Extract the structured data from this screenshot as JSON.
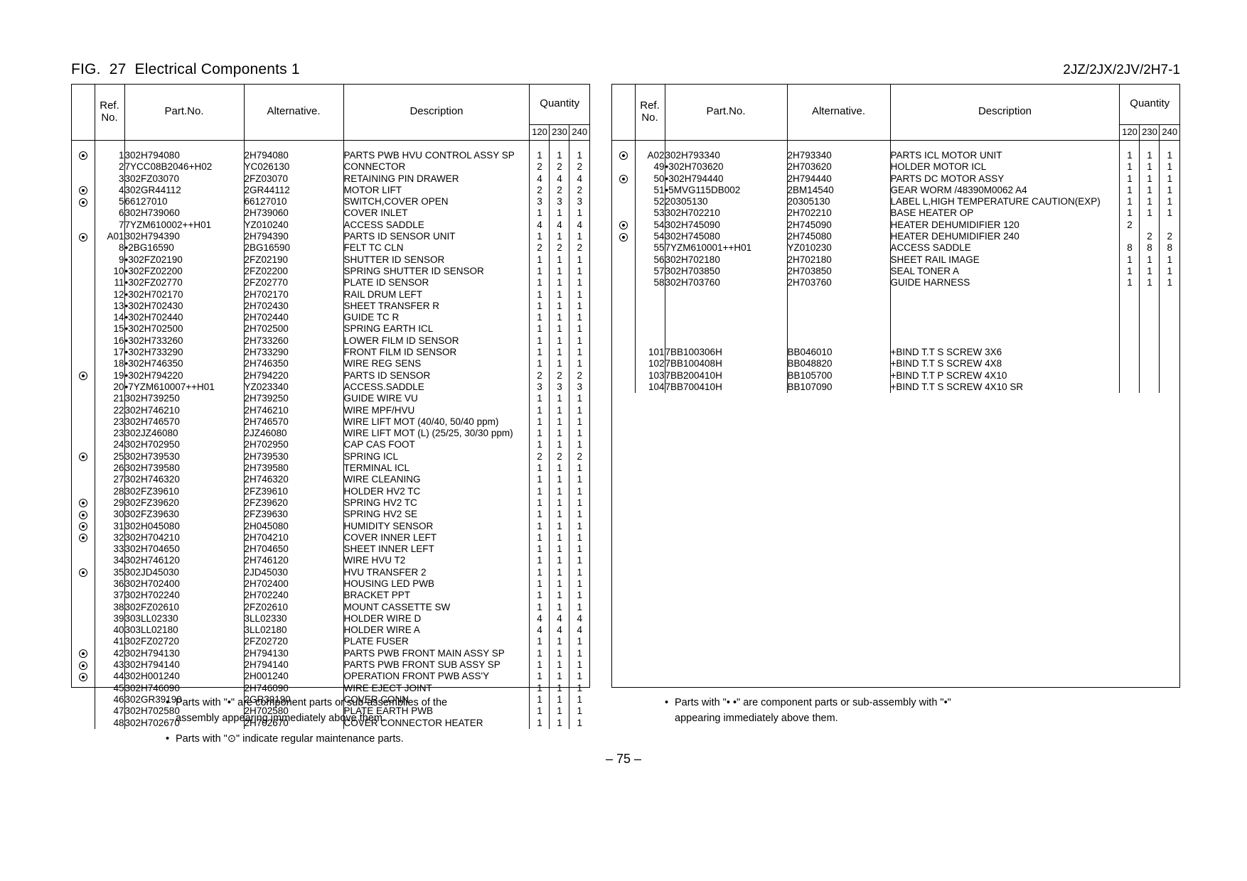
{
  "header": {
    "fig_title": "FIG.  27  Electrical Components 1",
    "model_code": "2JZ/2JX/2JV/2H7-1"
  },
  "columns": {
    "mark": "",
    "ref_line1": "Ref.",
    "ref_line2": "No.",
    "part": "Part.No.",
    "alternative": "Alternative.",
    "description": "Description",
    "quantity": "Quantity",
    "q120": "120",
    "q230": "230",
    "q240": "240"
  },
  "left_rows": [
    {
      "mark": true,
      "ref": "1",
      "part": "302H794080",
      "alt": "2H794080",
      "desc": "PARTS PWB HVU CONTROL ASSY SP",
      "q120": "1",
      "q230": "1",
      "q240": "1"
    },
    {
      "mark": false,
      "ref": "2",
      "part": "7YCC08B2046+H02",
      "alt": "YC026130",
      "desc": "CONNECTOR",
      "q120": "2",
      "q230": "2",
      "q240": "2"
    },
    {
      "mark": false,
      "ref": "3",
      "part": "302FZ03070",
      "alt": "2FZ03070",
      "desc": "RETAINING PIN DRAWER",
      "q120": "4",
      "q230": "4",
      "q240": "4"
    },
    {
      "mark": true,
      "ref": "4",
      "part": "302GR44112",
      "alt": "2GR44112",
      "desc": "MOTOR LIFT",
      "q120": "2",
      "q230": "2",
      "q240": "2"
    },
    {
      "mark": true,
      "ref": "5",
      "part": "66127010",
      "alt": "66127010",
      "desc": "SWITCH,COVER OPEN",
      "q120": "3",
      "q230": "3",
      "q240": "3"
    },
    {
      "mark": false,
      "ref": "6",
      "part": "302H739060",
      "alt": "2H739060",
      "desc": "COVER INLET",
      "q120": "1",
      "q230": "1",
      "q240": "1"
    },
    {
      "mark": false,
      "ref": "7",
      "part": "7YZM610002++H01",
      "alt": "YZ010240",
      "desc": "ACCESS SADDLE",
      "q120": "4",
      "q230": "4",
      "q240": "4"
    },
    {
      "mark": true,
      "ref": "A01",
      "part": "302H794390",
      "alt": "2H794390",
      "desc": "PARTS ID SENSOR UNIT",
      "q120": "1",
      "q230": "1",
      "q240": "1"
    },
    {
      "mark": false,
      "ref": "8",
      "part": "•2BG16590",
      "alt": "2BG16590",
      "desc": "FELT TC CLN",
      "q120": "2",
      "q230": "2",
      "q240": "2"
    },
    {
      "mark": false,
      "ref": "9",
      "part": "•302FZ02190",
      "alt": "2FZ02190",
      "desc": "SHUTTER ID SENSOR",
      "q120": "1",
      "q230": "1",
      "q240": "1"
    },
    {
      "mark": false,
      "ref": "10",
      "part": "•302FZ02200",
      "alt": "2FZ02200",
      "desc": "SPRING SHUTTER ID SENSOR",
      "q120": "1",
      "q230": "1",
      "q240": "1"
    },
    {
      "mark": false,
      "ref": "11",
      "part": "•302FZ02770",
      "alt": "2FZ02770",
      "desc": "PLATE ID SENSOR",
      "q120": "1",
      "q230": "1",
      "q240": "1"
    },
    {
      "mark": false,
      "ref": "12",
      "part": "•302H702170",
      "alt": "2H702170",
      "desc": "RAIL DRUM LEFT",
      "q120": "1",
      "q230": "1",
      "q240": "1"
    },
    {
      "mark": false,
      "ref": "13",
      "part": "•302H702430",
      "alt": "2H702430",
      "desc": "SHEET TRANSFER R",
      "q120": "1",
      "q230": "1",
      "q240": "1"
    },
    {
      "mark": false,
      "ref": "14",
      "part": "•302H702440",
      "alt": "2H702440",
      "desc": "GUIDE TC R",
      "q120": "1",
      "q230": "1",
      "q240": "1"
    },
    {
      "mark": false,
      "ref": "15",
      "part": "•302H702500",
      "alt": "2H702500",
      "desc": "SPRING EARTH ICL",
      "q120": "1",
      "q230": "1",
      "q240": "1"
    },
    {
      "mark": false,
      "ref": "16",
      "part": "•302H733260",
      "alt": "2H733260",
      "desc": "LOWER FILM ID SENSOR",
      "q120": "1",
      "q230": "1",
      "q240": "1"
    },
    {
      "mark": false,
      "ref": "17",
      "part": "•302H733290",
      "alt": "2H733290",
      "desc": "FRONT FILM ID SENSOR",
      "q120": "1",
      "q230": "1",
      "q240": "1"
    },
    {
      "mark": false,
      "ref": "18",
      "part": "•302H746350",
      "alt": "2H746350",
      "desc": "WIRE REG SENS",
      "q120": "1",
      "q230": "1",
      "q240": "1"
    },
    {
      "mark": true,
      "ref": "19",
      "part": "•302H794220",
      "alt": "2H794220",
      "desc": "PARTS ID SENSOR",
      "q120": "2",
      "q230": "2",
      "q240": "2"
    },
    {
      "mark": false,
      "ref": "20",
      "part": "•7YZM610007++H01",
      "alt": "YZ023340",
      "desc": "ACCESS.SADDLE",
      "q120": "3",
      "q230": "3",
      "q240": "3"
    },
    {
      "mark": false,
      "ref": "21",
      "part": "302H739250",
      "alt": "2H739250",
      "desc": "GUIDE WIRE VU",
      "q120": "1",
      "q230": "1",
      "q240": "1"
    },
    {
      "mark": false,
      "ref": "22",
      "part": "302H746210",
      "alt": "2H746210",
      "desc": "WIRE MPF/HVU",
      "q120": "1",
      "q230": "1",
      "q240": "1"
    },
    {
      "mark": false,
      "ref": "23",
      "part": "302H746570",
      "alt": "2H746570",
      "desc": "WIRE LIFT MOT (40/40, 50/40 ppm)",
      "q120": "1",
      "q230": "1",
      "q240": "1"
    },
    {
      "mark": false,
      "ref": "23",
      "part": "302JZ46080",
      "alt": "2JZ46080",
      "desc": "WIRE LIFT MOT (L) (25/25, 30/30 ppm)",
      "q120": "1",
      "q230": "1",
      "q240": "1"
    },
    {
      "mark": false,
      "ref": "24",
      "part": "302H702950",
      "alt": "2H702950",
      "desc": "CAP CAS FOOT",
      "q120": "1",
      "q230": "1",
      "q240": "1"
    },
    {
      "mark": true,
      "ref": "25",
      "part": "302H739530",
      "alt": "2H739530",
      "desc": "SPRING ICL",
      "q120": "2",
      "q230": "2",
      "q240": "2"
    },
    {
      "mark": false,
      "ref": "26",
      "part": "302H739580",
      "alt": "2H739580",
      "desc": "TERMINAL ICL",
      "q120": "1",
      "q230": "1",
      "q240": "1"
    },
    {
      "mark": false,
      "ref": "27",
      "part": "302H746320",
      "alt": "2H746320",
      "desc": "WIRE CLEANING",
      "q120": "1",
      "q230": "1",
      "q240": "1"
    },
    {
      "mark": false,
      "ref": "28",
      "part": "302FZ39610",
      "alt": "2FZ39610",
      "desc": "HOLDER HV2 TC",
      "q120": "1",
      "q230": "1",
      "q240": "1"
    },
    {
      "mark": true,
      "ref": "29",
      "part": "302FZ39620",
      "alt": "2FZ39620",
      "desc": "SPRING HV2 TC",
      "q120": "1",
      "q230": "1",
      "q240": "1"
    },
    {
      "mark": true,
      "ref": "30",
      "part": "302FZ39630",
      "alt": "2FZ39630",
      "desc": "SPRING HV2 SE",
      "q120": "1",
      "q230": "1",
      "q240": "1"
    },
    {
      "mark": true,
      "ref": "31",
      "part": "302H045080",
      "alt": "2H045080",
      "desc": "HUMIDITY SENSOR",
      "q120": "1",
      "q230": "1",
      "q240": "1"
    },
    {
      "mark": true,
      "ref": "32",
      "part": "302H704210",
      "alt": "2H704210",
      "desc": "COVER INNER LEFT",
      "q120": "1",
      "q230": "1",
      "q240": "1"
    },
    {
      "mark": false,
      "ref": "33",
      "part": "302H704650",
      "alt": "2H704650",
      "desc": "SHEET INNER LEFT",
      "q120": "1",
      "q230": "1",
      "q240": "1"
    },
    {
      "mark": false,
      "ref": "34",
      "part": "302H746120",
      "alt": "2H746120",
      "desc": "WIRE HVU T2",
      "q120": "1",
      "q230": "1",
      "q240": "1"
    },
    {
      "mark": true,
      "ref": "35",
      "part": "302JD45030",
      "alt": "2JD45030",
      "desc": "HVU TRANSFER 2",
      "q120": "1",
      "q230": "1",
      "q240": "1"
    },
    {
      "mark": false,
      "ref": "36",
      "part": "302H702400",
      "alt": "2H702400",
      "desc": "HOUSING LED PWB",
      "q120": "1",
      "q230": "1",
      "q240": "1"
    },
    {
      "mark": false,
      "ref": "37",
      "part": "302H702240",
      "alt": "2H702240",
      "desc": "BRACKET PPT",
      "q120": "1",
      "q230": "1",
      "q240": "1"
    },
    {
      "mark": false,
      "ref": "38",
      "part": "302FZ02610",
      "alt": "2FZ02610",
      "desc": "MOUNT CASSETTE SW",
      "q120": "1",
      "q230": "1",
      "q240": "1"
    },
    {
      "mark": false,
      "ref": "39",
      "part": "303LL02330",
      "alt": "3LL02330",
      "desc": "HOLDER WIRE D",
      "q120": "4",
      "q230": "4",
      "q240": "4"
    },
    {
      "mark": false,
      "ref": "40",
      "part": "303LL02180",
      "alt": "3LL02180",
      "desc": "HOLDER WIRE A",
      "q120": "4",
      "q230": "4",
      "q240": "4"
    },
    {
      "mark": false,
      "ref": "41",
      "part": "302FZ02720",
      "alt": "2FZ02720",
      "desc": "PLATE FUSER",
      "q120": "1",
      "q230": "1",
      "q240": "1"
    },
    {
      "mark": true,
      "ref": "42",
      "part": "302H794130",
      "alt": "2H794130",
      "desc": "PARTS PWB FRONT MAIN ASSY SP",
      "q120": "1",
      "q230": "1",
      "q240": "1"
    },
    {
      "mark": true,
      "ref": "43",
      "part": "302H794140",
      "alt": "2H794140",
      "desc": "PARTS PWB FRONT SUB ASSY SP",
      "q120": "1",
      "q230": "1",
      "q240": "1"
    },
    {
      "mark": true,
      "ref": "44",
      "part": "302H001240",
      "alt": "2H001240",
      "desc": "OPERATION FRONT PWB ASS'Y",
      "q120": "1",
      "q230": "1",
      "q240": "1"
    },
    {
      "mark": false,
      "ref": "45",
      "part": "302H746090",
      "alt": "2H746090",
      "desc": "WIRE EJECT JOINT",
      "q120": "1",
      "q230": "1",
      "q240": "1"
    },
    {
      "mark": false,
      "ref": "46",
      "part": "302GR39190",
      "alt": "2GR39190",
      "desc": "COVER CONN",
      "q120": "1",
      "q230": "1",
      "q240": "1"
    },
    {
      "mark": false,
      "ref": "47",
      "part": "302H702580",
      "alt": "2H702580",
      "desc": "PLATE EARTH PWB",
      "q120": "1",
      "q230": "1",
      "q240": "1"
    },
    {
      "mark": false,
      "ref": "48",
      "part": "302H702670",
      "alt": "2H702670",
      "desc": "COVER CONNECTOR HEATER",
      "q120": "1",
      "q230": "1",
      "q240": "1"
    }
  ],
  "right_rows": [
    {
      "mark": true,
      "ref": "A02",
      "part": "302H793340",
      "alt": "2H793340",
      "desc": "PARTS ICL MOTOR UNIT",
      "q120": "1",
      "q230": "1",
      "q240": "1"
    },
    {
      "mark": false,
      "ref": "49",
      "part": "•302H703620",
      "alt": "2H703620",
      "desc": "HOLDER MOTOR ICL",
      "q120": "1",
      "q230": "1",
      "q240": "1"
    },
    {
      "mark": true,
      "ref": "50",
      "part": "•302H794440",
      "alt": "2H794440",
      "desc": "PARTS DC MOTOR ASSY",
      "q120": "1",
      "q230": "1",
      "q240": "1"
    },
    {
      "mark": false,
      "ref": "51",
      "part": "•5MVG115DB002",
      "alt": "2BM14540",
      "desc": "GEAR WORM /48390M0062 A4",
      "q120": "1",
      "q230": "1",
      "q240": "1"
    },
    {
      "mark": false,
      "ref": "52",
      "part": "20305130",
      "alt": "20305130",
      "desc": "LABEL L,HIGH TEMPERATURE CAUTION(EXP)",
      "q120": "1",
      "q230": "1",
      "q240": "1"
    },
    {
      "mark": false,
      "ref": "53",
      "part": "302H702210",
      "alt": "2H702210",
      "desc": "BASE HEATER OP",
      "q120": "1",
      "q230": "1",
      "q240": "1"
    },
    {
      "mark": true,
      "ref": "54",
      "part": "302H745090",
      "alt": "2H745090",
      "desc": "HEATER DEHUMIDIFIER 120",
      "q120": "2",
      "q230": "",
      "q240": ""
    },
    {
      "mark": true,
      "ref": "54",
      "part": "302H745080",
      "alt": "2H745080",
      "desc": "HEATER DEHUMIDIFIER 240",
      "q120": "",
      "q230": "2",
      "q240": "2"
    },
    {
      "mark": false,
      "ref": "55",
      "part": "7YZM610001++H01",
      "alt": "YZ010230",
      "desc": "ACCESS SADDLE",
      "q120": "8",
      "q230": "8",
      "q240": "8"
    },
    {
      "mark": false,
      "ref": "56",
      "part": "302H702180",
      "alt": "2H702180",
      "desc": "SHEET RAIL IMAGE",
      "q120": "1",
      "q230": "1",
      "q240": "1"
    },
    {
      "mark": false,
      "ref": "57",
      "part": "302H703850",
      "alt": "2H703850",
      "desc": "SEAL TONER A",
      "q120": "1",
      "q230": "1",
      "q240": "1"
    },
    {
      "mark": false,
      "ref": "58",
      "part": "302H703760",
      "alt": "2H703760",
      "desc": "GUIDE HARNESS",
      "q120": "1",
      "q230": "1",
      "q240": "1"
    },
    {
      "mark": false,
      "ref": "",
      "part": "",
      "alt": "",
      "desc": "",
      "q120": "",
      "q230": "",
      "q240": ""
    },
    {
      "mark": false,
      "ref": "",
      "part": "",
      "alt": "",
      "desc": "",
      "q120": "",
      "q230": "",
      "q240": ""
    },
    {
      "mark": false,
      "ref": "",
      "part": "",
      "alt": "",
      "desc": "",
      "q120": "",
      "q230": "",
      "q240": ""
    },
    {
      "mark": false,
      "ref": "",
      "part": "",
      "alt": "",
      "desc": "",
      "q120": "",
      "q230": "",
      "q240": ""
    },
    {
      "mark": false,
      "ref": "",
      "part": "",
      "alt": "",
      "desc": "",
      "q120": "",
      "q230": "",
      "q240": ""
    },
    {
      "mark": false,
      "ref": "101",
      "part": "7BB100306H",
      "alt": "BB046010",
      "desc": "+BIND T.T S SCREW 3X6",
      "q120": "",
      "q230": "",
      "q240": ""
    },
    {
      "mark": false,
      "ref": "102",
      "part": "7BB100408H",
      "alt": "BB048820",
      "desc": "+BIND T.T S SCREW 4X8",
      "q120": "",
      "q230": "",
      "q240": ""
    },
    {
      "mark": false,
      "ref": "103",
      "part": "7BB200410H",
      "alt": "BB105700",
      "desc": "+BIND T.T P SCREW 4X10",
      "q120": "",
      "q230": "",
      "q240": ""
    },
    {
      "mark": false,
      "ref": "104",
      "part": "7BB700410H",
      "alt": "BB107090",
      "desc": "+BIND T.T S SCREW 4X10 SR",
      "q120": "",
      "q230": "",
      "q240": ""
    }
  ],
  "notes_left": {
    "bullet": "•",
    "line1": "Parts with \"•\" are component parts or sub-assemblies of the",
    "line1_cont": "assembly appearing immediately above them.",
    "line2": "Parts with \"⊙\" indicate regular maintenance parts."
  },
  "notes_right": {
    "bullet": "•",
    "line1": "Parts with \"• •\" are component parts or sub-assembly with \"•\"",
    "line1_cont": "appearing immediately above them."
  },
  "page_number": "–  75  –"
}
